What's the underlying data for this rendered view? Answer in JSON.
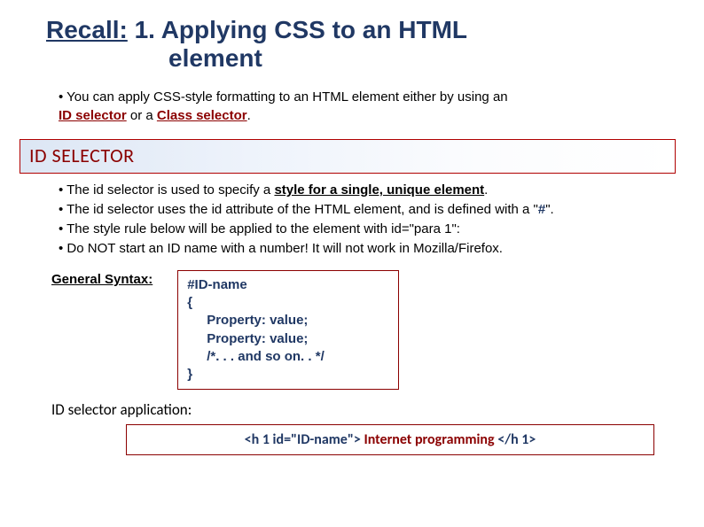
{
  "title": {
    "recall": "Recall:",
    "rest": " 1. Applying CSS to an HTML",
    "line2": "element"
  },
  "intro": {
    "pre": "• You can apply CSS-style formatting to an HTML element either by using an ",
    "id_sel": "ID selector",
    "mid": " or a ",
    "class_sel": "Class selector",
    "end": "."
  },
  "section_heading": "ID SELECTOR",
  "bullets": {
    "b1a": "• The id selector is used to specify a ",
    "b1u": "style for a single, unique element",
    "b1b": ".",
    "b2a": "• The id selector uses the id attribute of the HTML element, and is defined with a \"",
    "b2hash": "#",
    "b2b": "\".",
    "b3": "• The style rule below will be applied to the element with id=\"para 1\":",
    "b4": "• Do NOT start an ID name with a number! It will not work in Mozilla/Firefox."
  },
  "general_syntax_label": "General Syntax:",
  "syntax": {
    "l1": "#ID-name",
    "l2": "{",
    "l3": "Property: value;",
    "l4": "Property: value;",
    "l5": "/*. . . and so on. . */",
    "l6": "}"
  },
  "app_label": "ID selector application:",
  "app_box": {
    "open": "<h 1 id=\"ID-name\"> ",
    "text": " Internet programming ",
    "close": " </h 1>"
  }
}
